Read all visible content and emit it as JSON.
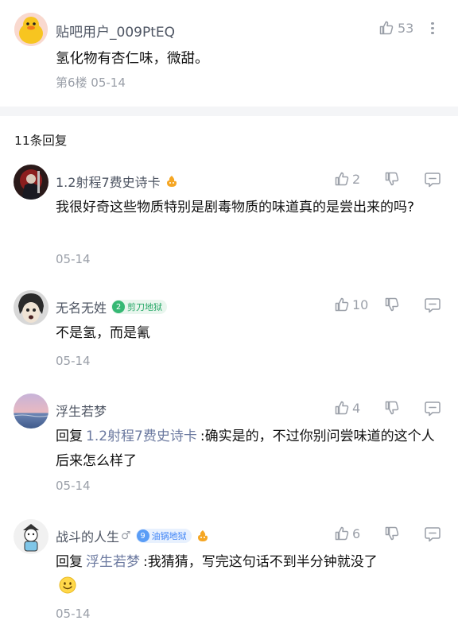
{
  "post": {
    "username": "贴吧用户_009PtEQ",
    "text": "氢化物有杏仁味，微甜。",
    "floor": "第6楼 05-14",
    "likes": "53"
  },
  "reply_count": "11条回复",
  "replies": [
    {
      "username": "1.2射程7费史诗卡",
      "text": "我很好奇这些物质特别是剧毒物质的味道真的是尝出来的吗?",
      "date": "05-14",
      "likes": "2",
      "avatar_color": "#5a2a2a"
    },
    {
      "username": "无名无姓",
      "badge_level": "2",
      "badge_text": "剪刀地狱",
      "text": "不是氢，而是氰",
      "date": "05-14",
      "likes": "10",
      "avatar_color": "#3d3d3d"
    },
    {
      "username": "浮生若梦",
      "reply_label": "回复",
      "reply_to": "1.2射程7费史诗卡",
      "text": ":确实是的，不过你别问尝味道的这个人后来怎么样了",
      "date": "05-14",
      "likes": "4",
      "avatar_color": "#7f8fb8"
    },
    {
      "username": "战斗的人生",
      "gender_icon": "♂",
      "badge_level": "9",
      "badge_text": "油锅地狱",
      "reply_label": "回复",
      "reply_to": "浮生若梦",
      "text": ":我猜猜，写完这句话不到半分钟就没了",
      "date": "05-14",
      "likes": "6",
      "avatar_color": "#e8e8e8"
    }
  ]
}
